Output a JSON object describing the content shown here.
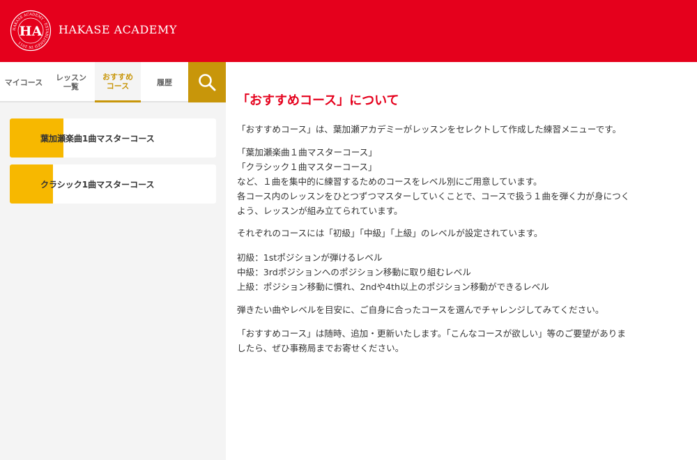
{
  "header": {
    "brand": "HAKASE ACADEMY",
    "logo_text": "HA",
    "logo_ring_text": "HAKASE ACADEMY · ESTABLISHED IN 2011",
    "bg_color": "#e5001c"
  },
  "sidebar": {
    "tabs": [
      {
        "label": "マイコース",
        "active": false
      },
      {
        "label": "レッスン\n一覧",
        "active": false
      },
      {
        "label": "おすすめ\nコース",
        "active": true
      },
      {
        "label": "履歴",
        "active": false
      }
    ],
    "search_icon": "search-icon",
    "accent_color": "#c8960a",
    "courses": [
      {
        "title": "葉加瀬楽曲1曲マスターコース",
        "progress": 0.26
      },
      {
        "title": "クラシック1曲マスターコース",
        "progress": 0.21
      }
    ]
  },
  "main": {
    "title": "「おすすめコース」について",
    "paragraphs": [
      [
        "「おすすめコース」は、葉加瀬アカデミーがレッスンをセレクトして作成した練習メニューです。"
      ],
      [
        "「葉加瀬楽曲１曲マスターコース」",
        "「クラシック１曲マスターコース」",
        "など、１曲を集中的に練習するためのコースをレベル別にご用意しています。",
        "各コース内のレッスンをひとつずつマスターしていくことで、コースで扱う１曲を弾く力が身につく",
        "よう、レッスンが組み立てられています。"
      ],
      [
        "それぞれのコースには「初級」「中級」「上級」のレベルが設定されています。"
      ],
      [
        "初級：1stポジションが弾けるレベル",
        "中級：3rdポジションへのポジション移動に取り組むレベル",
        "上級：ポジション移動に慣れ、2ndや4th以上のポジション移動ができるレベル"
      ],
      [
        "弾きたい曲やレベルを目安に、ご自身に合ったコースを選んでチャレンジしてみてください。"
      ],
      [
        "「おすすめコース」は随時、追加・更新いたします。「こんなコースが欲しい」等のご要望がありま",
        "したら、ぜひ事務局までお寄せください。"
      ]
    ]
  }
}
